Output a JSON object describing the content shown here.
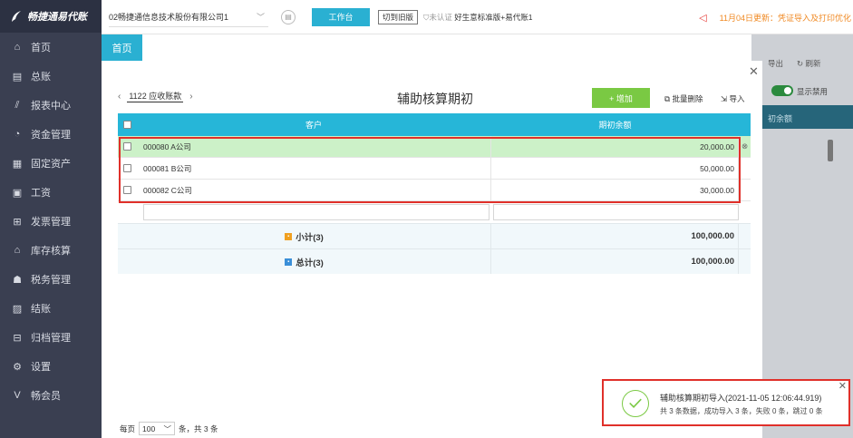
{
  "app": {
    "logo_text": "畅捷通易代账"
  },
  "sidebar": {
    "items": [
      {
        "label": "首页",
        "icon": "home-icon"
      },
      {
        "label": "总账",
        "icon": "ledger-icon"
      },
      {
        "label": "报表中心",
        "icon": "chart-icon"
      },
      {
        "label": "资金管理",
        "icon": "money-icon"
      },
      {
        "label": "固定资产",
        "icon": "asset-icon"
      },
      {
        "label": "工资",
        "icon": "salary-icon"
      },
      {
        "label": "发票管理",
        "icon": "invoice-icon"
      },
      {
        "label": "库存核算",
        "icon": "warehouse-icon"
      },
      {
        "label": "税务管理",
        "icon": "tax-icon"
      },
      {
        "label": "结账",
        "icon": "close-book-icon"
      },
      {
        "label": "归档管理",
        "icon": "archive-icon"
      },
      {
        "label": "设置",
        "icon": "gear-icon"
      },
      {
        "label": "畅会员",
        "icon": "vip-icon"
      }
    ]
  },
  "topbar": {
    "company": "02畅捷通信息技术股份有限公司1",
    "workbench": "工作台",
    "switch_old": "切到旧版",
    "cert_status": "未认证",
    "edition": "好生意标准版+易代账1",
    "notice": "11月04日更新：凭证导入及打印优化"
  },
  "tabs": {
    "home": "首页"
  },
  "background": {
    "export": "导出",
    "refresh": "刷新",
    "show_disabled": "显示禁用",
    "col_header": "初余额"
  },
  "modal": {
    "title": "辅助核算期初",
    "account": "1122 应收账款",
    "add_label": "+ 增加",
    "batch_delete": "批量删除",
    "import": "导入",
    "columns": {
      "customer": "客户",
      "balance": "期初余额"
    },
    "rows": [
      {
        "customer": "000080 A公司",
        "balance": "20,000.00"
      },
      {
        "customer": "000081 B公司",
        "balance": "50,000.00"
      },
      {
        "customer": "000082 C公司",
        "balance": "30,000.00"
      }
    ],
    "subtotal_label": "小计(3)",
    "subtotal_value": "100,000.00",
    "total_label": "总计(3)",
    "total_value": "100,000.00",
    "pager": {
      "per_page_label": "每页",
      "per_page": "100",
      "summary": "条，共 3 条"
    }
  },
  "toast": {
    "title": "辅助核算期初导入(2021-11-05 12:06:44.919)",
    "detail": "共 3 条数据，成功导入 3 条，失败 0 条，跳过 0 条"
  },
  "colors": {
    "sidebar": "#3a3f51",
    "accent": "#2ab0d2",
    "add": "#7ac943",
    "highlight": "#e0302a"
  }
}
